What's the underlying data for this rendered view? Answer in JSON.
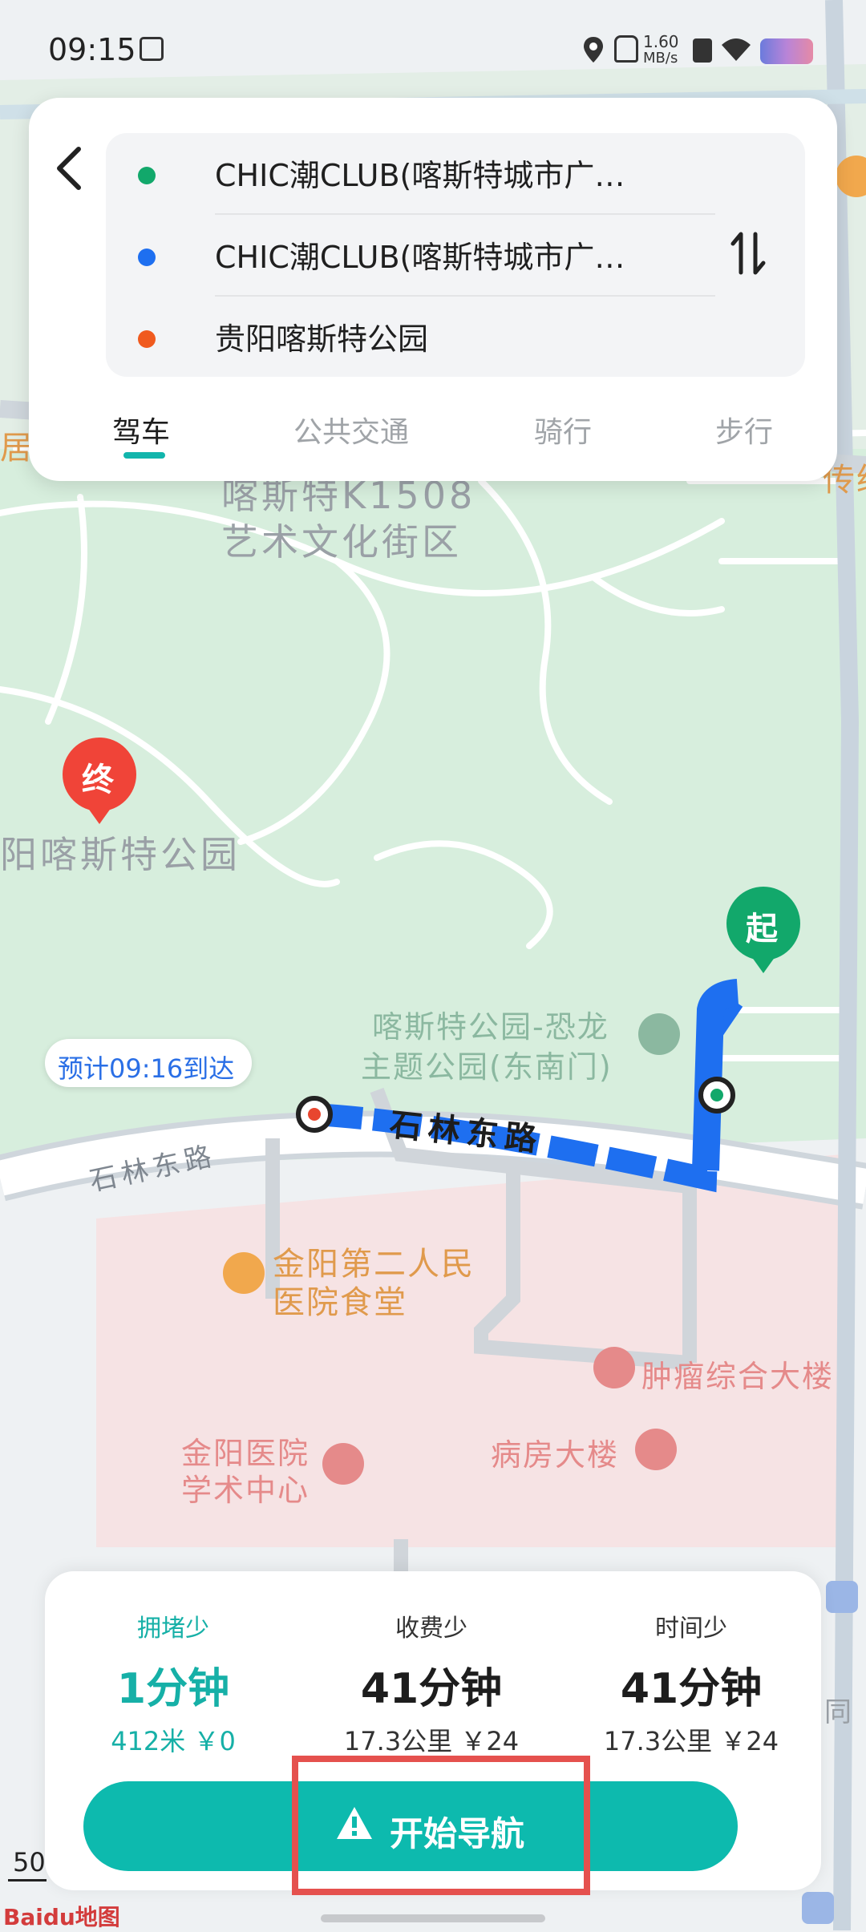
{
  "status": {
    "time": "09:15",
    "net_speed": "1.60",
    "net_unit": "MB/s"
  },
  "route": {
    "start": "CHIC潮CLUB(喀斯特城市广…",
    "via": "CHIC潮CLUB(喀斯特城市广…",
    "destination": "贵阳喀斯特公园"
  },
  "tabs": [
    "驾车",
    "公共交通",
    "骑行",
    "步行"
  ],
  "map": {
    "labels": {
      "art_block_1": "喀斯特K1508",
      "art_block_2": "艺术文化街区",
      "park_name": "阳喀斯特公园",
      "dino_gate_1": "喀斯特公园-恐龙",
      "dino_gate_2": "主题公园(东南门)",
      "road_main": "石林东路",
      "road_left": "石林东路",
      "canteen_1": "金阳第二人民",
      "canteen_2": "医院食堂",
      "tumor_building": "肿瘤综合大楼",
      "academic_1": "金阳医院",
      "academic_2": "学术中心",
      "ward_building": "病房大楼",
      "edge_right_top": "传统",
      "edge_left": "居",
      "edge_right_bottom": "同"
    },
    "end_marker": "终",
    "start_marker": "起",
    "eta": "预计09:16到达",
    "scale": "50",
    "logo_text": "Baidu地图"
  },
  "options": [
    {
      "title": "拥堵少",
      "time": "1分钟",
      "meta": "412米 ￥0",
      "selected": true
    },
    {
      "title": "收费少",
      "time": "41分钟",
      "meta": "17.3公里 ￥24",
      "selected": false
    },
    {
      "title": "时间少",
      "time": "41分钟",
      "meta": "17.3公里 ￥24",
      "selected": false
    }
  ],
  "nav_button": "开始导航",
  "colors": {
    "accent": "#0dbaae",
    "route_blue": "#1e6ff0",
    "start_green": "#12a86b",
    "end_red": "#f04438",
    "highlight": "#e5514e"
  },
  "icons": [
    "back-arrow-icon",
    "swap-icon",
    "navigation-arrow-icon",
    "location-icon",
    "wifi-icon",
    "battery-icon"
  ]
}
